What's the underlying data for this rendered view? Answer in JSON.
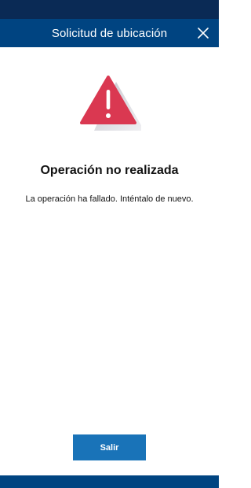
{
  "header": {
    "title": "Solicitud de ubicación",
    "close_icon": "close-icon"
  },
  "main": {
    "icon": "warning-icon",
    "heading": "Operación no realizada",
    "message": "La operación ha fallado. Inténtalo de nuevo.",
    "exit_button_label": "Salir"
  },
  "colors": {
    "header": "#004481",
    "status_bar": "#0a2a55",
    "warning": "#da3851",
    "button": "#1973b8"
  }
}
